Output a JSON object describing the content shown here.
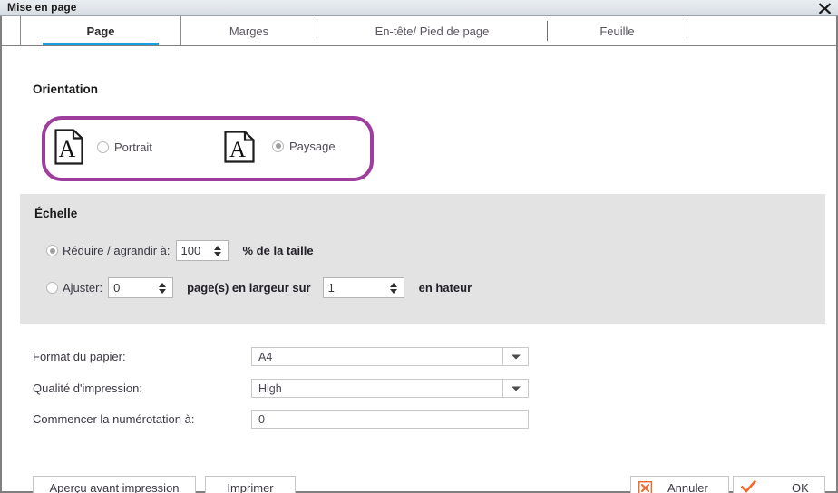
{
  "window": {
    "title": "Mise en page",
    "close_icon": "close-x-icon"
  },
  "tabs": [
    {
      "label": "Page",
      "active": true
    },
    {
      "label": "Marges",
      "active": false
    },
    {
      "label": "En-tête/ Pied de page",
      "active": false
    },
    {
      "label": "Feuille",
      "active": false
    }
  ],
  "orientation": {
    "section_label": "Orientation",
    "highlight_color": "#9e3d9e",
    "options": [
      {
        "label": "Portrait",
        "selected": false,
        "icon": "page-portrait-icon"
      },
      {
        "label": "Paysage",
        "selected": true,
        "icon": "page-landscape-icon"
      }
    ]
  },
  "scale": {
    "section_label": "Échelle",
    "reduce": {
      "radio_label": "Réduire / agrandir à:",
      "selected": true,
      "value": "100",
      "suffix": "% de la taille"
    },
    "fit": {
      "radio_label": "Ajuster:",
      "selected": false,
      "width_value": "0",
      "middle_text": "page(s) en largeur sur",
      "height_value": "1",
      "suffix": "en hateur"
    }
  },
  "form": {
    "paper_format": {
      "label": "Format du papier:",
      "value": "A4"
    },
    "print_quality": {
      "label": "Qualité d'impression:",
      "value": "High"
    },
    "start_numbering": {
      "label": "Commencer la numérotation à:",
      "value": "0"
    }
  },
  "buttons": {
    "preview": "Aperçu avant impression",
    "print": "Imprimer",
    "cancel": "Annuler",
    "ok": "OK",
    "cancel_icon": "cancel-x-box-icon",
    "ok_icon": "checkmark-icon",
    "accent_color": "#f2682a"
  }
}
